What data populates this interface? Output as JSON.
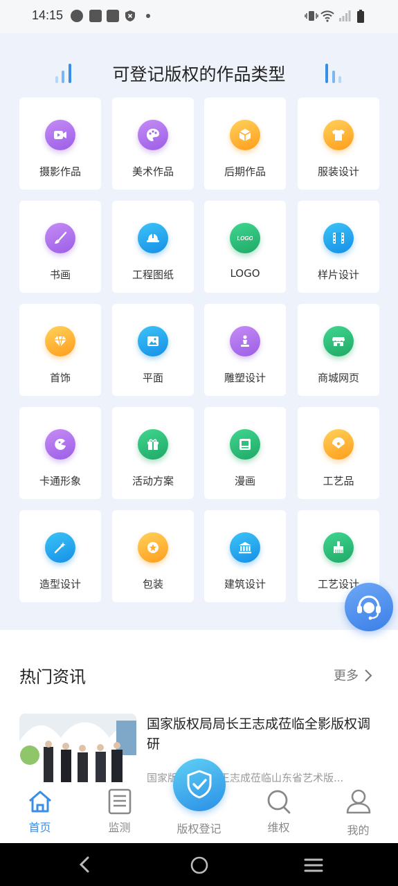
{
  "status_bar": {
    "time": "14:15"
  },
  "grid": {
    "title": "可登记版权的作品类型",
    "items": [
      {
        "label": "摄影作品",
        "icon": "video-camera-icon",
        "color": "purple"
      },
      {
        "label": "美术作品",
        "icon": "palette-icon",
        "color": "purple"
      },
      {
        "label": "后期作品",
        "icon": "cube-icon",
        "color": "orange"
      },
      {
        "label": "服装设计",
        "icon": "tshirt-icon",
        "color": "orange"
      },
      {
        "label": "书画",
        "icon": "brush-icon",
        "color": "purple"
      },
      {
        "label": "工程图纸",
        "icon": "hardhat-icon",
        "color": "blue"
      },
      {
        "label": "LOGO",
        "icon": "logo-icon",
        "color": "green"
      },
      {
        "label": "样片设计",
        "icon": "film-icon",
        "color": "blue"
      },
      {
        "label": "首饰",
        "icon": "diamond-icon",
        "color": "orange"
      },
      {
        "label": "平面",
        "icon": "image-icon",
        "color": "blue"
      },
      {
        "label": "雕塑设计",
        "icon": "sculpture-icon",
        "color": "purple"
      },
      {
        "label": "商城网页",
        "icon": "store-icon",
        "color": "green"
      },
      {
        "label": "卡通形象",
        "icon": "cartoon-icon",
        "color": "purple"
      },
      {
        "label": "活动方案",
        "icon": "gift-icon",
        "color": "green"
      },
      {
        "label": "漫画",
        "icon": "comic-book-icon",
        "color": "green"
      },
      {
        "label": "工艺品",
        "icon": "fan-icon",
        "color": "orange"
      },
      {
        "label": "造型设计",
        "icon": "magic-wand-icon",
        "color": "blue"
      },
      {
        "label": "包装",
        "icon": "package-icon",
        "color": "orange"
      },
      {
        "label": "建筑设计",
        "icon": "building-icon",
        "color": "blue"
      },
      {
        "label": "工艺设计",
        "icon": "craft-icon",
        "color": "green"
      }
    ]
  },
  "news": {
    "section_title": "热门资讯",
    "more_label": "更多",
    "items": [
      {
        "title": "国家版权局局长王志成莅临全影版权调研",
        "summary": "国家版权局局长王志成莅临山东省艺术版..."
      }
    ]
  },
  "tabbar": {
    "tabs": [
      {
        "label": "首页",
        "icon": "home-icon",
        "active": true
      },
      {
        "label": "监测",
        "icon": "document-icon",
        "active": false
      },
      {
        "label": "版权登记",
        "icon": "shield-check-icon",
        "active": false
      },
      {
        "label": "维权",
        "icon": "search-icon",
        "active": false
      },
      {
        "label": "我的",
        "icon": "user-icon",
        "active": false
      }
    ]
  },
  "colors": {
    "accent": "#3a8ee6",
    "purple": "#a56ae8",
    "orange": "#ffad2a",
    "green": "#2fc07a",
    "blue": "#1da7ee",
    "background": "#eef3fb"
  }
}
